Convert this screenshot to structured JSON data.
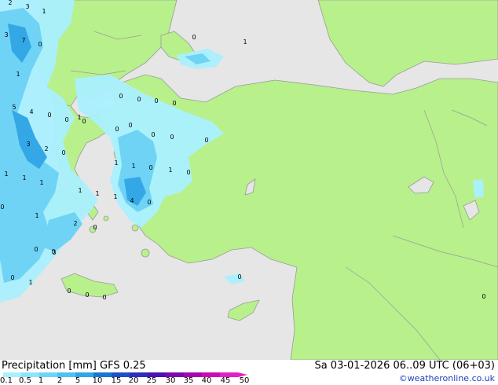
{
  "footer": {
    "title": "Precipitation [mm]  GFS 0.25",
    "valid_time": "Sa 03-01-2026 06..09 UTC (06+03)",
    "credit": "©weatheronline.co.uk"
  },
  "legend": {
    "labels": [
      "0.1",
      "0.5",
      "1",
      "2",
      "5",
      "10",
      "15",
      "20",
      "25",
      "30",
      "35",
      "40",
      "45",
      "50"
    ],
    "colors": [
      "#a8f0ff",
      "#8ce4fa",
      "#6fd5f5",
      "#4fc2ee",
      "#2ea6e3",
      "#1877d4",
      "#1d4fc8",
      "#2a2fbf",
      "#4a12b3",
      "#7a0ab0",
      "#a806b0",
      "#cf07b5",
      "#e61fc4"
    ]
  },
  "map_colors": {
    "sea": "#e6e6e6",
    "land": "#b8f08c",
    "precip_light": "#aaf0ff",
    "precip_medium": "#6fd3f5",
    "precip_heavy": "#34a8e6"
  },
  "precip_values": [
    "2",
    "3",
    "1",
    "7",
    "0",
    "3",
    "0",
    "1",
    "1",
    "5",
    "4",
    "0",
    "0",
    "1",
    "0",
    "0",
    "0",
    "0",
    "0",
    "0",
    "0",
    "0",
    "0",
    "0",
    "3",
    "2",
    "0",
    "1",
    "1",
    "1",
    "1",
    "1",
    "0",
    "1",
    "0",
    "1",
    "1",
    "1",
    "4",
    "0",
    "0",
    "0",
    "1",
    "2",
    "0",
    "0",
    "3",
    "0",
    "1",
    "0",
    "0",
    "0",
    "0",
    "0"
  ]
}
